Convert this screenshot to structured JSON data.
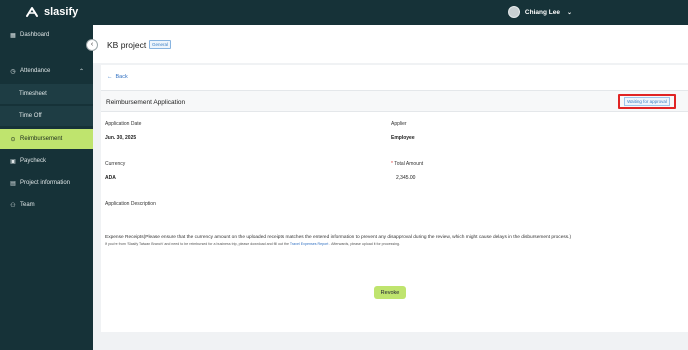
{
  "app": {
    "brand": "slasify"
  },
  "user": {
    "name": "Chiang Lee"
  },
  "sidebar": {
    "items": [
      {
        "label": "Dashboard"
      },
      {
        "label": "Attendance"
      },
      {
        "label": "Timesheet"
      },
      {
        "label": "Time Off"
      },
      {
        "label": "Reimbursement"
      },
      {
        "label": "Paycheck"
      },
      {
        "label": "Project information"
      },
      {
        "label": "Team"
      }
    ]
  },
  "header": {
    "project_title": "KB project",
    "project_badge": "General"
  },
  "main": {
    "back_label": "Back",
    "section_title": "Reimbursement Application",
    "status_badge": "Waiting for approval",
    "fields": {
      "application_date_label": "Application Date",
      "application_date_value": "Jun. 30, 2025",
      "applier_label": "Applier",
      "applier_value": "Employee",
      "currency_label": "Currency",
      "currency_value": "ADA",
      "total_amount_label": "Total Amount",
      "total_amount_value": "2,345.00",
      "description_label": "Application Description"
    },
    "receipts_note": "Expense Receipts(Please ensure that the currency amount on the uploaded receipts matches the entered information to prevent any disapproval during the review, which might cause delays in the disbursement process.)",
    "receipts_sub_before": "If you're from 'Slasify Taiwan Branch' and need to be reimbursed for a business trip, please download and fill out the",
    "receipts_sub_link": "Travel Expenses Report",
    "receipts_sub_after": ". Afterwards, please upload it for processing.",
    "revoke_label": "Revoke"
  },
  "colors": {
    "sidebar_bg": "#163238",
    "accent": "#bfe46e",
    "highlight_border": "#e02424",
    "link": "#2f6fc1"
  }
}
